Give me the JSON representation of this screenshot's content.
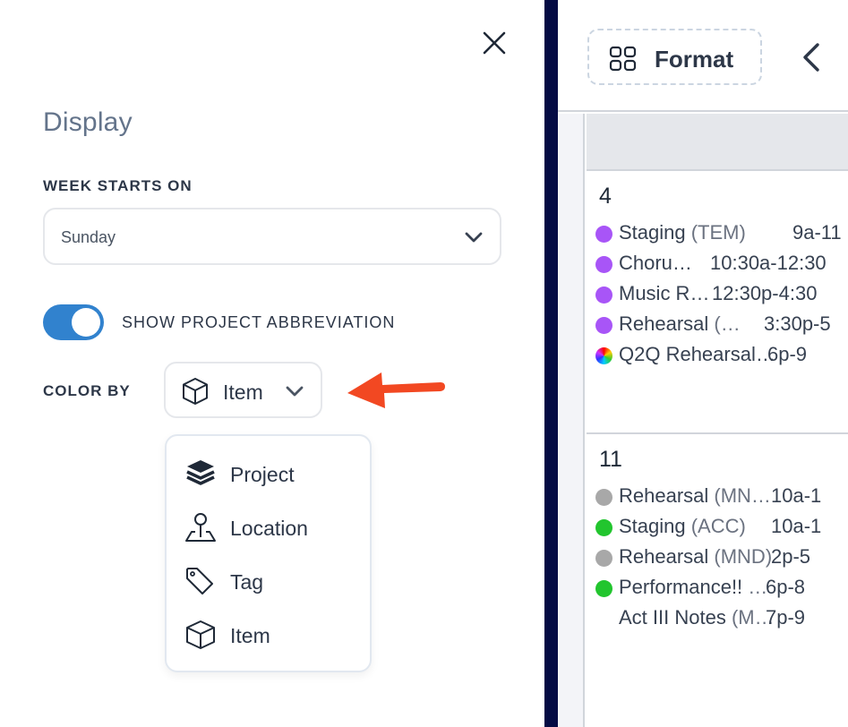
{
  "panel": {
    "title": "Display",
    "week_starts_on": {
      "label": "WEEK STARTS ON",
      "value": "Sunday"
    },
    "show_project_abbreviation": {
      "label": "SHOW PROJECT ABBREVIATION",
      "enabled": true
    },
    "color_by": {
      "label": "COLOR BY",
      "value": "Item",
      "icon": "cube-icon",
      "options": [
        {
          "label": "Project",
          "icon": "layers-icon"
        },
        {
          "label": "Location",
          "icon": "map-pin-icon"
        },
        {
          "label": "Tag",
          "icon": "tag-icon"
        },
        {
          "label": "Item",
          "icon": "cube-icon"
        }
      ]
    },
    "annotation_arrow_color": "#f24822"
  },
  "toolbar": {
    "format_label": "Format"
  },
  "colors": {
    "accent": "#3182ce",
    "divider": "#040b44",
    "purple": "#a855f7",
    "green": "#22c52e",
    "gray": "#a8a8a8"
  },
  "calendar": {
    "days": [
      {
        "day": "4",
        "events": [
          {
            "name": "Staging",
            "abbr": "(TEM)",
            "time": "9a-11",
            "dot": "purple"
          },
          {
            "name": "Choru…",
            "abbr": "",
            "time": "10:30a-12:30",
            "dot": "purple"
          },
          {
            "name": "Music R…",
            "abbr": "",
            "time": "12:30p-4:30",
            "dot": "purple"
          },
          {
            "name": "Rehearsal",
            "abbr": "(…",
            "time": "3:30p-5",
            "dot": "purple"
          },
          {
            "name": "Q2Q Rehearsal…",
            "abbr": "",
            "time": "6p-9",
            "dot": "rainbow"
          }
        ]
      },
      {
        "day": "11",
        "events": [
          {
            "name": "Rehearsal",
            "abbr": "(MN…",
            "time": "10a-1",
            "dot": "gray"
          },
          {
            "name": "Staging",
            "abbr": "(ACC)",
            "time": "10a-1",
            "dot": "green"
          },
          {
            "name": "Rehearsal",
            "abbr": "(MND)",
            "time": "2p-5",
            "dot": "gray"
          },
          {
            "name": "Performance!!",
            "abbr": "…",
            "time": "6p-8",
            "dot": "green"
          },
          {
            "name": "Act III Notes",
            "abbr": "(M…",
            "time": "7p-9",
            "dot": "none"
          }
        ]
      }
    ]
  }
}
